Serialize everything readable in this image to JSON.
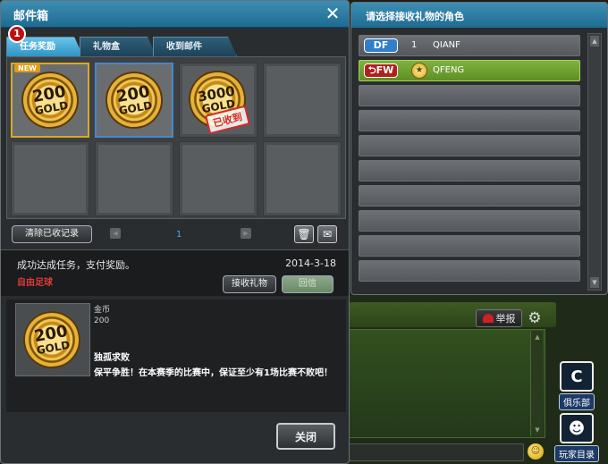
{
  "mailbox": {
    "title": "邮件箱",
    "tab_badge": "1",
    "tabs": [
      {
        "label": "任务奖励"
      },
      {
        "label": "礼物盒"
      },
      {
        "label": "收到邮件"
      }
    ],
    "items": [
      {
        "amount": "200",
        "unit": "GOLD",
        "tag": "NEW"
      },
      {
        "amount": "200",
        "unit": "GOLD"
      },
      {
        "amount": "3000",
        "unit": "GOLD",
        "stamp": "已收到"
      }
    ],
    "clear_button": "清除已收记录",
    "page": "1",
    "message": {
      "text": "成功达成任务，支付奖励。",
      "date": "2014-3-18",
      "sender": "自由足球",
      "accept_button": "接收礼物",
      "reply_button": "回信",
      "item_name": "金币",
      "item_count": "200",
      "item_amount": "200",
      "item_unit": "GOLD",
      "mission_title": "独孤求败",
      "mission_desc": "保平争胜！在本赛季的比赛中，保证至少有1场比赛不败吧！"
    },
    "close_button": "关闭"
  },
  "character_panel": {
    "title": "请选择接收礼物的角色",
    "rows": [
      {
        "position": "DF",
        "number": "1",
        "name": "QIANF"
      },
      {
        "position": "FW",
        "name": "QFENG"
      }
    ],
    "empty_rows": 8
  },
  "background": {
    "report_button": "举报",
    "club_label": "俱乐部",
    "players_label": "玩家目录"
  },
  "colors": {
    "title_bar": "#1f6b92",
    "selected_row": "#5f8f24",
    "df_badge": "#2f80c8",
    "fw_badge": "#b2201d",
    "sender": "#e23a3a"
  }
}
